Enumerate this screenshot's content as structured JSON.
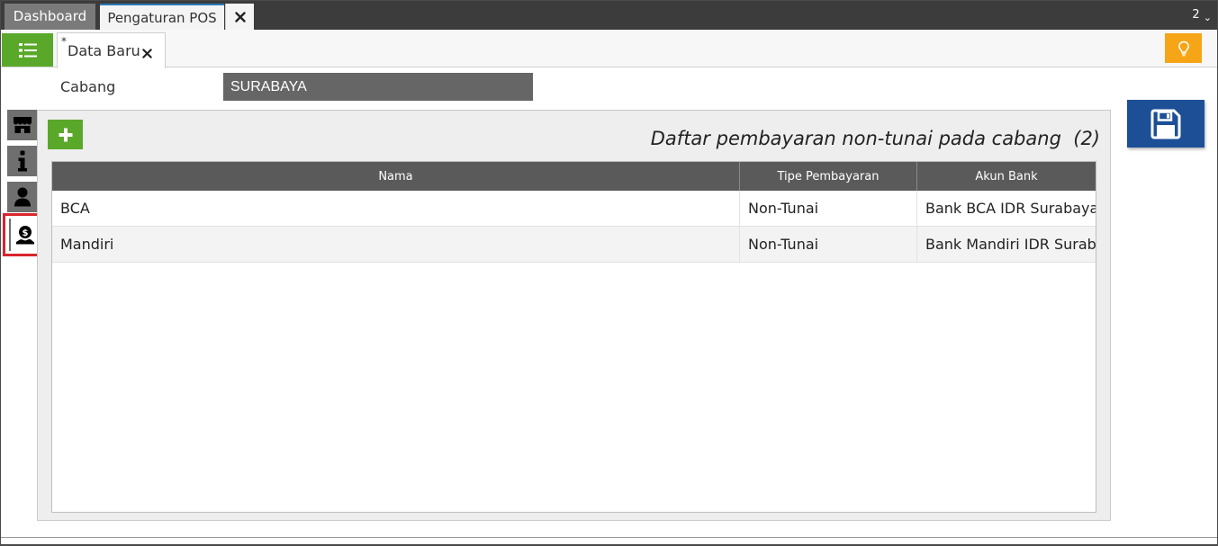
{
  "tabs": {
    "dashboard": "Dashboard",
    "active": "Pengaturan POS",
    "count": "2"
  },
  "doc_tab": {
    "modified_mark": "*",
    "label": "Data Baru"
  },
  "form": {
    "cabang_label": "Cabang",
    "cabang_value": "SURABAYA"
  },
  "panel": {
    "title": "Daftar pembayaran non-tunai pada cabang  (2)"
  },
  "table": {
    "columns": [
      "Nama",
      "Tipe Pembayaran",
      "Akun Bank"
    ],
    "rows": [
      [
        "BCA",
        "Non-Tunai",
        "Bank BCA IDR Surabaya..."
      ],
      [
        "Mandiri",
        "Non-Tunai",
        "Bank Mandiri IDR Surab..."
      ]
    ]
  },
  "icons": {
    "menu": "list-icon",
    "close": "close-icon",
    "bulb": "lightbulb-icon",
    "store": "store-icon",
    "info": "info-icon",
    "user": "user-icon",
    "payment": "money-hand-icon",
    "save": "floppy-disk-icon",
    "add": "plus-icon"
  },
  "colors": {
    "green": "#5aa82a",
    "orange": "#f5a516",
    "save_blue": "#1c4f96",
    "highlight_red": "#d9252b",
    "dark_bar": "#3c3c3c"
  }
}
